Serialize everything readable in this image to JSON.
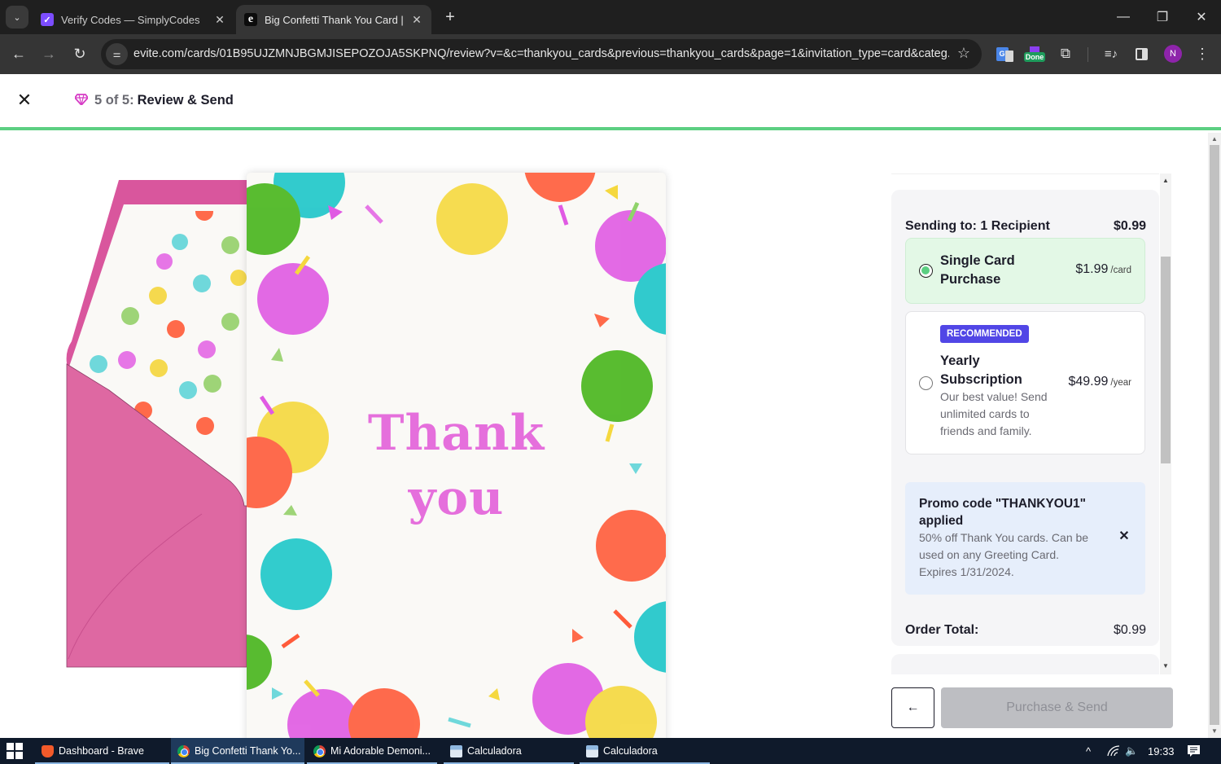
{
  "browser": {
    "tabs": [
      {
        "title": "Verify Codes — SimplyCodes",
        "favicon": "simplycodes-icon",
        "active": false
      },
      {
        "title": "Big Confetti Thank You Card | Ev",
        "favicon": "evite-icon",
        "active": true
      }
    ],
    "tab_list_icon": "⌄",
    "new_tab_icon": "+",
    "close_tab_icon": "✕",
    "window_controls": {
      "minimize": "—",
      "restore": "❐",
      "close": "✕"
    },
    "url": "evite.com/cards/01B95UJZMNJBGMJISEPOZOJA5SKPNQ/review?v=&c=thankyou_cards&previous=thankyou_cards&page=1&invitation_type=card&categ...",
    "nav": {
      "back": "←",
      "forward": "→",
      "reload": "↻"
    },
    "extensions": {
      "translate_label": "G",
      "done_label": "Done"
    },
    "profile_initial": "N"
  },
  "header": {
    "close_icon": "✕",
    "step_icon": "gem-icon",
    "step_count": "5 of 5:",
    "step_title": "Review & Send",
    "progress": 1.0,
    "progress_color": "#5ccf82"
  },
  "card_preview": {
    "line1": "Thank",
    "line2": "you",
    "text_color": "#e56fdc"
  },
  "summary": {
    "sending_to_label": "Sending to: 1 Recipient",
    "sending_to_price": "$0.99",
    "options": [
      {
        "title_line1": "Single Card",
        "title_line2": "Purchase",
        "price": "$1.99",
        "unit": "/card",
        "selected": true
      },
      {
        "badge": "RECOMMENDED",
        "title_line1": "Yearly",
        "title_line2": "Subscription",
        "price": "$49.99",
        "unit": "/year",
        "description": "Our best value! Send unlimited cards to friends and family.",
        "selected": false
      }
    ],
    "promo": {
      "title": "Promo code \"THANKYOU1\" applied",
      "description": "50% off Thank You cards. Can be used on any Greeting Card. Expires 1/31/2024.",
      "remove_icon": "✕"
    },
    "order_total_label": "Order Total:",
    "order_total": "$0.99"
  },
  "actions": {
    "back_icon": "←",
    "purchase_label": "Purchase & Send"
  },
  "taskbar": {
    "apps": [
      {
        "label": "Dashboard - Brave",
        "icon": "brave-icon",
        "active": false
      },
      {
        "label": "Big Confetti Thank Yo...",
        "icon": "chrome-icon",
        "active": true
      },
      {
        "label": "Mi Adorable Demoni...",
        "icon": "chrome-icon",
        "active": false
      },
      {
        "label": "Calculadora",
        "icon": "calculator-icon",
        "active": false
      },
      {
        "label": "Calculadora",
        "icon": "calculator-icon",
        "active": false
      }
    ],
    "clock": "19:33",
    "tray_icons": {
      "chevron": "^",
      "wifi": "wifi-icon",
      "volume": "🔈",
      "notifications": "notification-icon"
    }
  }
}
